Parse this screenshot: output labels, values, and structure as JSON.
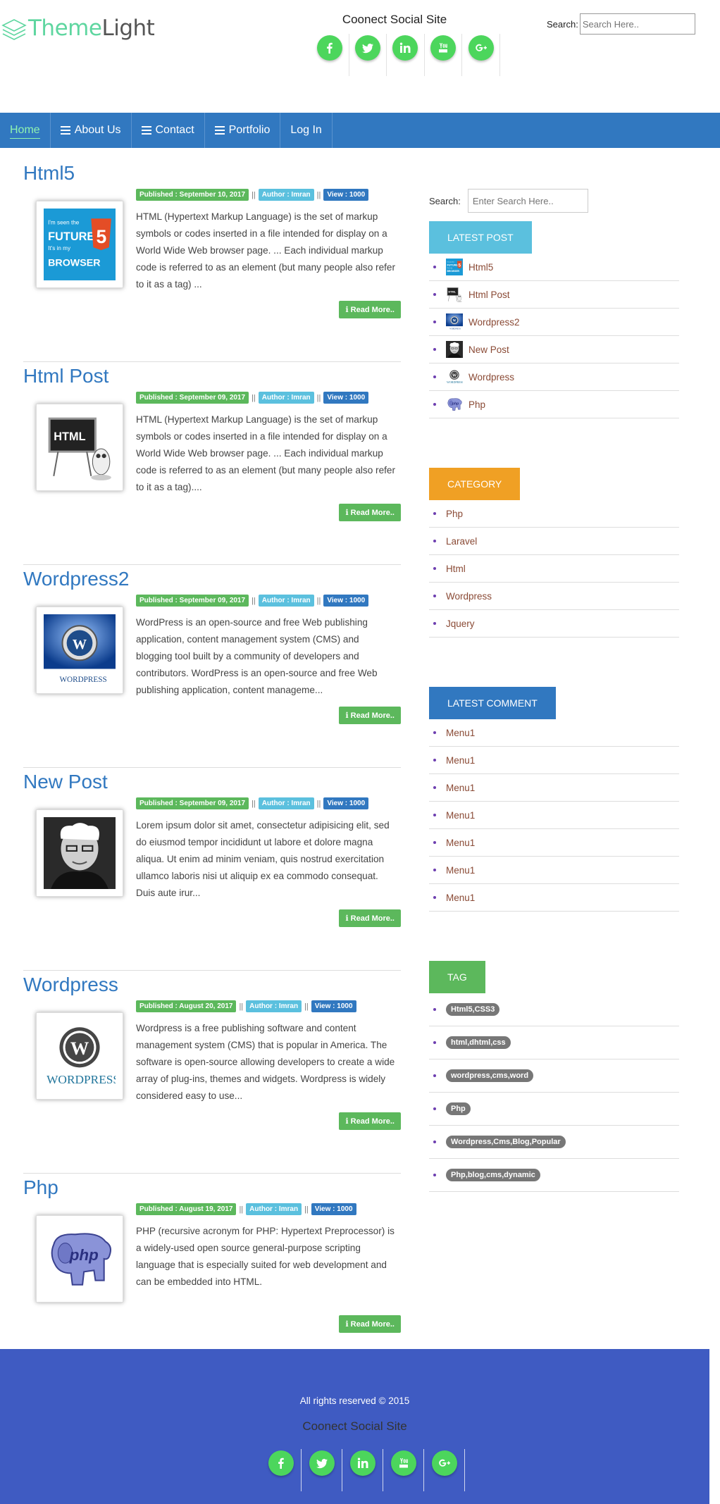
{
  "header": {
    "logo": {
      "part1": "Theme",
      "part2": "Light"
    },
    "social_title": "Coonect Social Site",
    "social": [
      {
        "icon": "facebook-icon",
        "glyph": "f"
      },
      {
        "icon": "twitter-icon",
        "glyph": "t"
      },
      {
        "icon": "linkedin-icon",
        "glyph": "in"
      },
      {
        "icon": "youtube-icon",
        "glyph": "yt"
      },
      {
        "icon": "googleplus-icon",
        "glyph": "g+"
      }
    ],
    "search_label": "Search:",
    "search_placeholder": "Search Here.."
  },
  "nav": {
    "items": [
      {
        "label": "Home",
        "icon": false,
        "active": true
      },
      {
        "label": "About Us",
        "icon": true,
        "active": false
      },
      {
        "label": "Contact",
        "icon": true,
        "active": false
      },
      {
        "label": "Portfolio",
        "icon": true,
        "active": false
      },
      {
        "label": "Log In",
        "icon": false,
        "active": false
      }
    ]
  },
  "posts": [
    {
      "title": "Html5",
      "published": "Published : September 10, 2017",
      "author": "Author : Imran",
      "views": "View : 1000",
      "excerpt": "HTML (Hypertext Markup Language) is the set of markup symbols or codes inserted in a file intended for display on a World Wide Web browser page. ... Each individual markup code is referred to as an element (but many people also refer to it as a tag) ...",
      "read_more": "ℹ Read More..",
      "thumb": "html5"
    },
    {
      "title": "Html Post",
      "published": "Published : September 09, 2017",
      "author": "Author : Imran",
      "views": "View : 1000",
      "excerpt": "HTML (Hypertext Markup Language) is the set of markup symbols or codes inserted in a file intended for display on a World Wide Web browser page. ... Each individual markup code is referred to as an element (but many people also refer to it as a tag)....",
      "read_more": "ℹ Read More..",
      "thumb": "html"
    },
    {
      "title": "Wordpress2",
      "published": "Published : September 09, 2017",
      "author": "Author : Imran",
      "views": "View : 1000",
      "excerpt": "WordPress is an open-source and free Web publishing application, content management system (CMS) and blogging tool built by a community of developers and contributors. WordPress is an open-source and free Web publishing application, content manageme...",
      "read_more": "ℹ Read More..",
      "thumb": "wp2"
    },
    {
      "title": "New Post",
      "published": "Published : September 09, 2017",
      "author": "Author : Imran",
      "views": "View : 1000",
      "excerpt": "Lorem ipsum dolor sit amet, consectetur adipisicing elit, sed do eiusmod tempor incididunt ut labore et dolore magna aliqua. Ut enim ad minim veniam, quis nostrud exercitation ullamco laboris nisi ut aliquip ex ea commodo consequat. Duis aute irur...",
      "read_more": "ℹ Read More..",
      "thumb": "person"
    },
    {
      "title": "Wordpress",
      "published": "Published : August 20, 2017",
      "author": "Author : Imran",
      "views": "View : 1000",
      "excerpt": "Wordpress is a free publishing software and content management system (CMS) that is popular in America. The software is open-source allowing developers to create a wide array of plug-ins, themes and widgets. Wordpress is widely considered easy to use...",
      "read_more": "ℹ Read More..",
      "thumb": "wp"
    },
    {
      "title": "Php",
      "published": "Published : August 19, 2017",
      "author": "Author : Imran",
      "views": "View : 1000",
      "excerpt": "PHP (recursive acronym for PHP: Hypertext Preprocessor) is a widely-used open source general-purpose scripting language that is especially suited for web development and can be embedded into HTML.",
      "read_more": "ℹ Read More..",
      "thumb": "php"
    }
  ],
  "sidebar": {
    "search_label": "Search:",
    "search_placeholder": "Enter Search Here..",
    "latest_title": "LATEST POST",
    "latest": [
      {
        "label": "Html5",
        "thumb": "html5"
      },
      {
        "label": "Html Post",
        "thumb": "html"
      },
      {
        "label": "Wordpress2",
        "thumb": "wp2"
      },
      {
        "label": "New Post",
        "thumb": "person"
      },
      {
        "label": "Wordpress",
        "thumb": "wp"
      },
      {
        "label": "Php",
        "thumb": "php"
      }
    ],
    "category_title": "CATEGORY",
    "categories": [
      "Php",
      "Laravel",
      "Html",
      "Wordpress",
      "Jquery"
    ],
    "comment_title": "LATEST COMMENT",
    "comments": [
      "Menu1",
      "Menu1",
      "Menu1",
      "Menu1",
      "Menu1",
      "Menu1",
      "Menu1"
    ],
    "tag_title": "TAG",
    "tags": [
      "Html5,CSS3",
      "html,dhtml,css",
      "wordpress,cms,word",
      "Php",
      "Wordpress,Cms,Blog,Popular",
      "Php,blog,cms,dynamic"
    ]
  },
  "footer": {
    "copyright": "All rights reserved © 2015",
    "social_title": "Coonect Social Site"
  },
  "colors": {
    "nav": "#3178c0",
    "footer": "#3f5bc2",
    "social": "#4cd65c",
    "published": "#5cb85c",
    "author": "#5bc0de",
    "views": "#3178c0",
    "category": "#f0a024"
  }
}
